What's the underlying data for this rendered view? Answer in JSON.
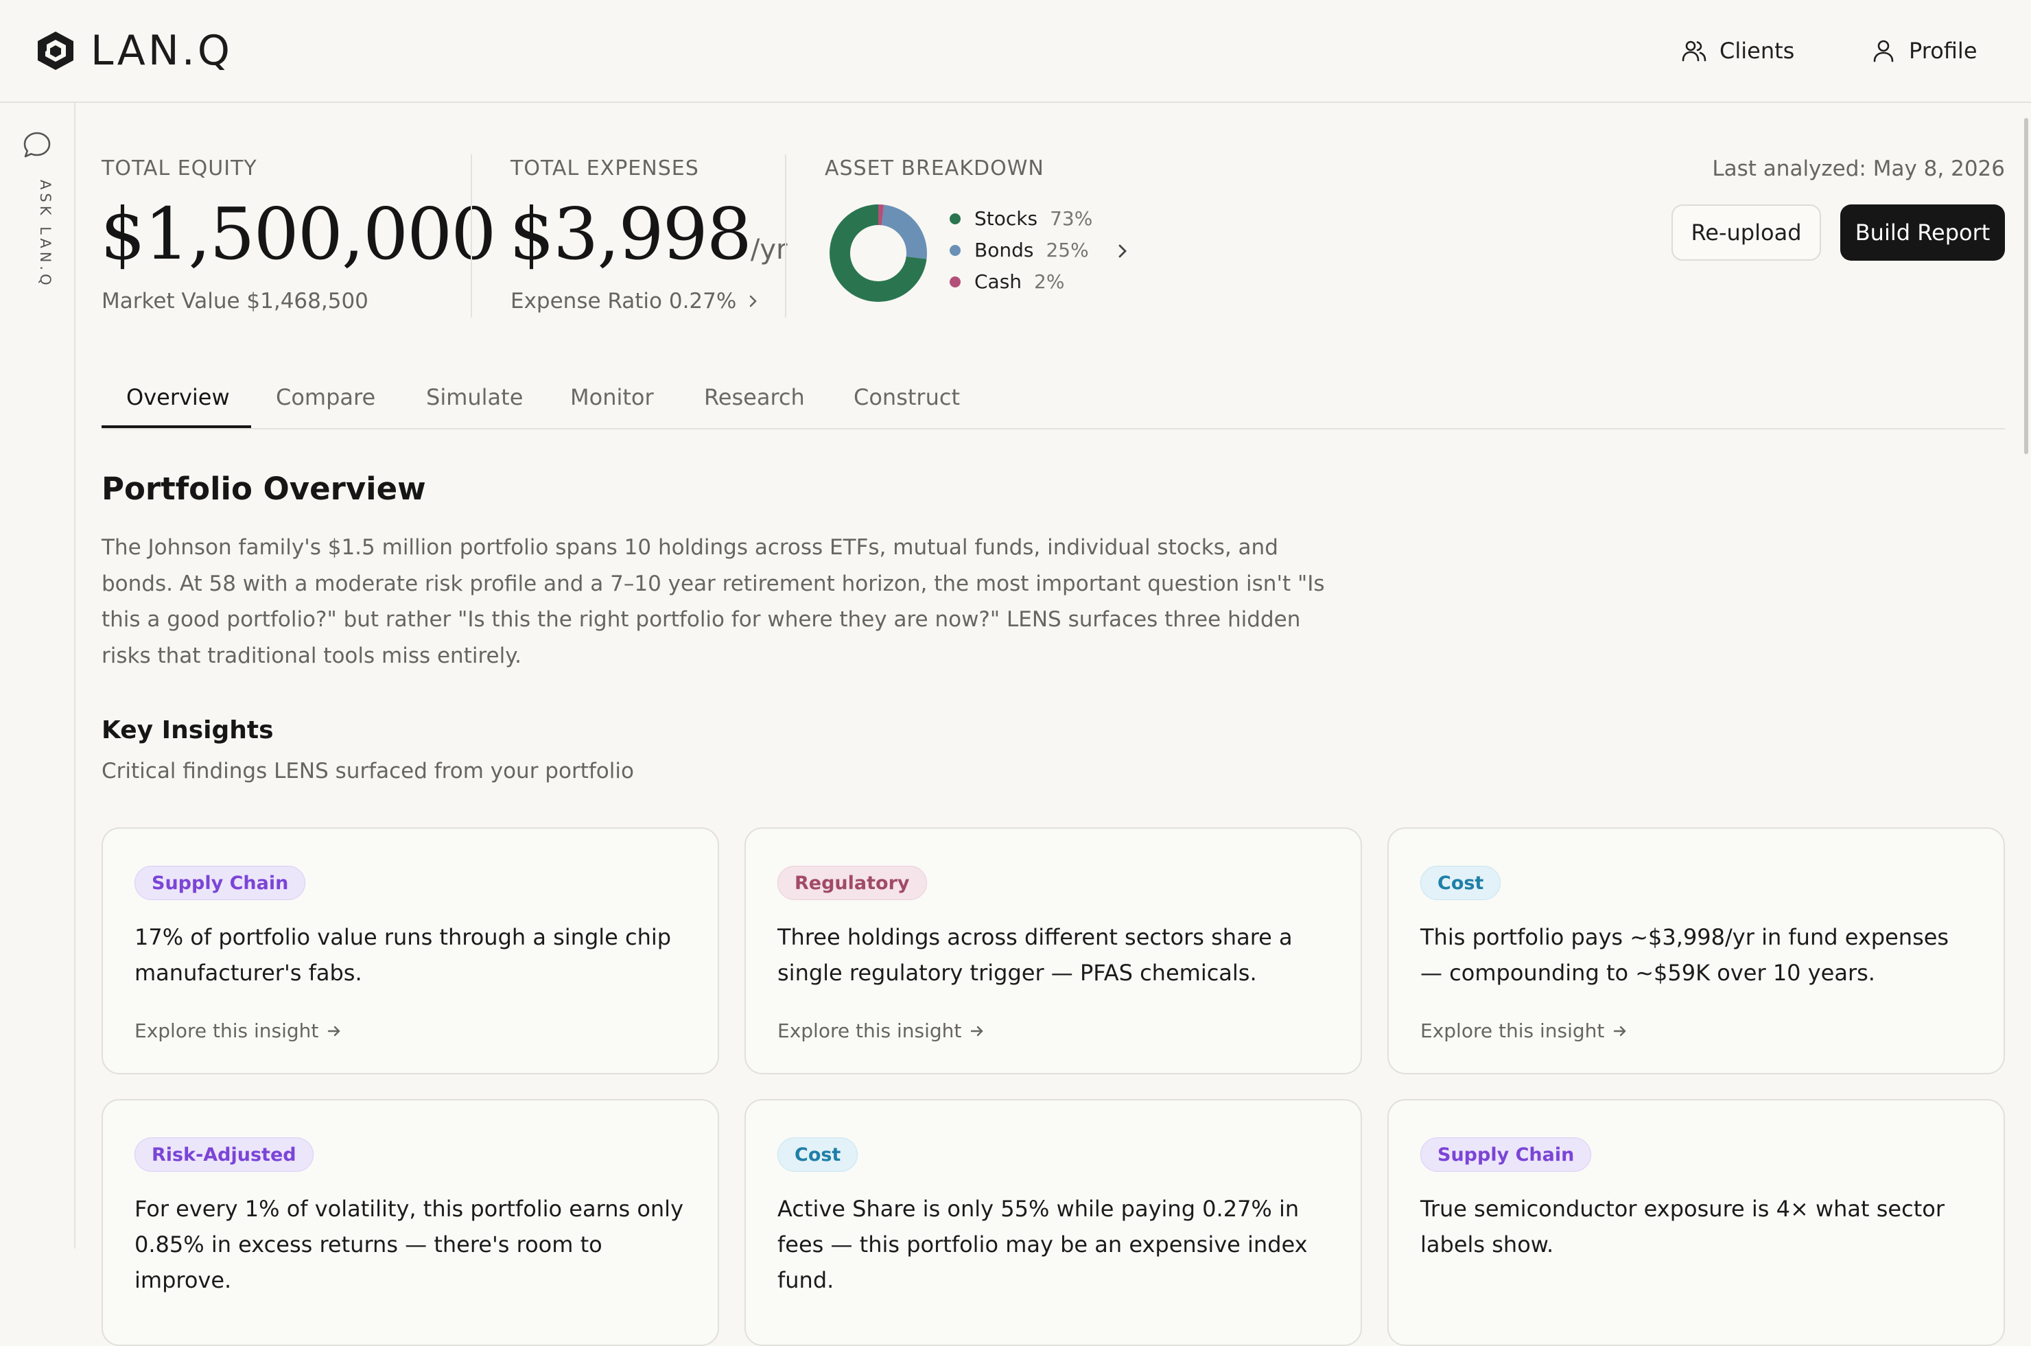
{
  "brand": {
    "name": "LAN.Q"
  },
  "header": {
    "clients_label": "Clients",
    "profile_label": "Profile"
  },
  "rail": {
    "ask_label": "ASK LAN.Q"
  },
  "summary": {
    "total_equity": {
      "label": "TOTAL EQUITY",
      "value": "$1,500,000",
      "sub": "Market Value $1,468,500"
    },
    "total_expenses": {
      "label": "TOTAL EXPENSES",
      "value": "$3,998",
      "unit": "/yr",
      "sub": "Expense Ratio 0.27%"
    },
    "asset_breakdown": {
      "label": "ASSET BREAKDOWN",
      "items": [
        {
          "name": "Stocks",
          "pct": "73%",
          "value": 73,
          "color": "#2a7550"
        },
        {
          "name": "Bonds",
          "pct": "25%",
          "value": 25,
          "color": "#6a90b6"
        },
        {
          "name": "Cash",
          "pct": "2%",
          "value": 2,
          "color": "#b35079"
        }
      ]
    },
    "last_analyzed": "Last analyzed: May 8, 2026",
    "reupload_label": "Re-upload",
    "build_report_label": "Build Report"
  },
  "tabs": [
    {
      "label": "Overview",
      "active": true
    },
    {
      "label": "Compare"
    },
    {
      "label": "Simulate"
    },
    {
      "label": "Monitor"
    },
    {
      "label": "Research"
    },
    {
      "label": "Construct"
    }
  ],
  "overview": {
    "title": "Portfolio Overview",
    "body": "The Johnson family's $1.5 million portfolio spans 10 holdings across ETFs, mutual funds, individual stocks, and bonds. At 58 with a moderate risk profile and a 7–10 year retirement horizon, the most important question isn't \"Is this a good portfolio?\" but rather \"Is this the right portfolio for where they are now?\" LENS surfaces three hidden risks that traditional tools miss entirely."
  },
  "insights": {
    "title": "Key Insights",
    "subtitle": "Critical findings LENS surfaced from your portfolio",
    "link_label": "Explore this insight",
    "cards": [
      {
        "tag": "Supply Chain",
        "text": "17% of portfolio value runs through a single chip manufacturer's fabs."
      },
      {
        "tag": "Regulatory",
        "text": "Three holdings across different sectors share a single regulatory trigger — PFAS chemicals."
      },
      {
        "tag": "Cost",
        "text": "This portfolio pays ~$3,998/yr in fund expenses — compounding to ~$59K over 10 years."
      },
      {
        "tag": "Risk-Adjusted",
        "text": "For every 1% of volatility, this portfolio earns only 0.85% in excess returns — there's room to improve."
      },
      {
        "tag": "Cost",
        "text": "Active Share is only 55% while paying 0.27% in fees — this portfolio may be an expensive index fund."
      },
      {
        "tag": "Supply Chain",
        "text": "True semiconductor exposure is 4× what sector labels show."
      }
    ]
  }
}
